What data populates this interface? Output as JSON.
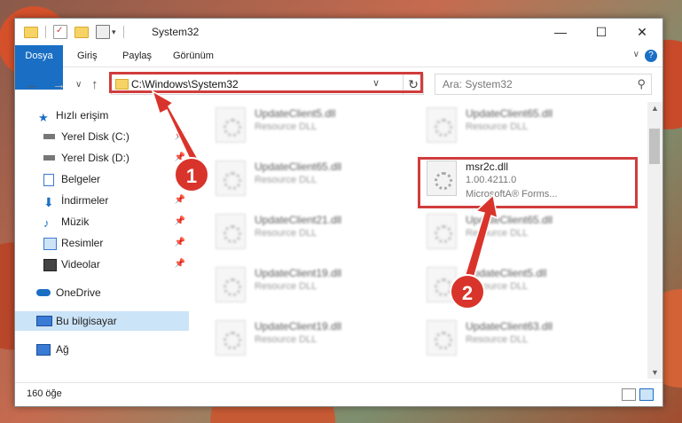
{
  "window": {
    "title": "System32",
    "controls": {
      "minimize": "—",
      "maximize": "☐",
      "close": "✕"
    }
  },
  "ribbon": {
    "tabs": [
      "Dosya",
      "Giriş",
      "Paylaş",
      "Görünüm"
    ],
    "help": "?"
  },
  "address": {
    "path": "C:\\Windows\\System32",
    "search_placeholder": "Ara: System32"
  },
  "nav": {
    "items": [
      {
        "label": "Hızlı erişim",
        "icon": "star-icon",
        "pinned": false
      },
      {
        "label": "Yerel Disk (C:)",
        "icon": "drive-icon",
        "pinned": true
      },
      {
        "label": "Yerel Disk (D:)",
        "icon": "drive-icon",
        "pinned": true
      },
      {
        "label": "Belgeler",
        "icon": "documents-icon",
        "pinned": true
      },
      {
        "label": "İndirmeler",
        "icon": "download-icon",
        "pinned": true
      },
      {
        "label": "Müzik",
        "icon": "music-icon",
        "pinned": true
      },
      {
        "label": "Resimler",
        "icon": "pictures-icon",
        "pinned": true
      },
      {
        "label": "Videolar",
        "icon": "video-icon",
        "pinned": true
      },
      {
        "label": "OneDrive",
        "icon": "cloud-icon",
        "pinned": false
      },
      {
        "label": "Bu bilgisayar",
        "icon": "computer-icon",
        "pinned": false
      },
      {
        "label": "Ağ",
        "icon": "network-icon",
        "pinned": false
      }
    ]
  },
  "files": {
    "left_column": [
      {
        "name": "UpdateClient5.dll",
        "desc": "Resource DLL"
      },
      {
        "name": "UpdateClient65.dll",
        "desc": "Resource DLL"
      },
      {
        "name": "UpdateClient21.dll",
        "desc": "Resource DLL"
      },
      {
        "name": "UpdateClient19.dll",
        "desc": "Resource DLL"
      },
      {
        "name": "UpdateClient19.dll",
        "desc": "Resource DLL"
      }
    ],
    "right_column": [
      {
        "name": "UpdateClient65.dll",
        "desc": "Resource DLL"
      },
      {
        "name": "msr2c.dll",
        "desc": "1.00.4211.0",
        "desc2": "MicrosoftA® Forms..."
      },
      {
        "name": "UpdateClient65.dll",
        "desc": "Resource DLL"
      },
      {
        "name": "UpdateClient5.dll",
        "desc": "Resource DLL"
      },
      {
        "name": "UpdateClient63.dll",
        "desc": "Resource DLL"
      }
    ]
  },
  "status": {
    "count": "160 öğe"
  },
  "callouts": {
    "one": "1",
    "two": "2"
  },
  "colors": {
    "accent": "#1a6fc4",
    "highlight": "#d13c3c",
    "badge": "#d9342b"
  }
}
